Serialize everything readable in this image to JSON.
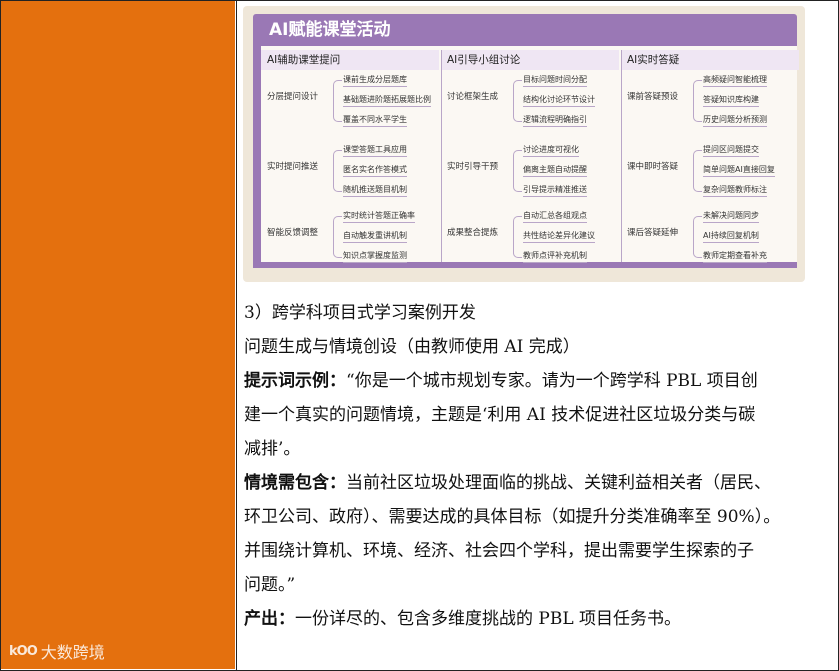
{
  "watermark": {
    "logo": "kOO",
    "text": "大数跨境"
  },
  "figure": {
    "title": "AI赋能课堂活动",
    "columns": [
      {
        "heading": "AI辅助课堂提问",
        "groups": [
          {
            "label": "分层提问设计",
            "leaves": [
              "课前生成分层题库",
              "基础题进阶题拓展题比例",
              "覆盖不同水平学生"
            ]
          },
          {
            "label": "实时提问推送",
            "leaves": [
              "课堂答题工具应用",
              "匿名实名作答模式",
              "随机推送题目机制"
            ]
          },
          {
            "label": "智能反馈调整",
            "leaves": [
              "实时统计答题正确率",
              "自动触发重讲机制",
              "知识点掌握度监测"
            ]
          }
        ]
      },
      {
        "heading": "AI引导小组讨论",
        "groups": [
          {
            "label": "讨论框架生成",
            "leaves": [
              "目标问题时间分配",
              "结构化讨论环节设计",
              "逻辑流程明确指引"
            ]
          },
          {
            "label": "实时引导干预",
            "leaves": [
              "讨论进度可视化",
              "偏离主题自动提醒",
              "引导提示精准推送"
            ]
          },
          {
            "label": "成果整合提炼",
            "leaves": [
              "自动汇总各组观点",
              "共性结论差异化建议",
              "教师点评补充机制"
            ]
          }
        ]
      },
      {
        "heading": "AI实时答疑",
        "groups": [
          {
            "label": "课前答疑预设",
            "leaves": [
              "高频疑问智能梳理",
              "答疑知识库构建",
              "历史问题分析预测"
            ]
          },
          {
            "label": "课中即时答疑",
            "leaves": [
              "提问区问题提交",
              "简单问题AI直接回复",
              "复杂问题教师标注"
            ]
          },
          {
            "label": "课后答疑延伸",
            "leaves": [
              "未解决问题同步",
              "AI持续回复机制",
              "教师定期查看补充"
            ]
          }
        ]
      }
    ]
  },
  "text": {
    "line1": "3）跨学科项目式学习案例开发",
    "line2": "问题生成与情境创设（由教师使用 AI 完成）",
    "prompt_label": "提示词示例：",
    "prompt_l1": "“你是一个城市规划专家。请为一个跨学科 PBL 项目创",
    "prompt_l2": "建一个真实的问题情境，主题是‘利用 AI 技术促进社区垃圾分类与碳",
    "prompt_l3": "减排’。",
    "context_label": "情境需包含：",
    "context_l1": "当前社区垃圾处理面临的挑战、关键利益相关者（居民、",
    "context_l2": "环卫公司、政府）、需要达成的具体目标（如提升分类准确率至 90%）。",
    "context_l3": "并围绕计算机、环境、经济、社会四个学科，提出需要学生探索的子",
    "context_l4": "问题。”",
    "output_label": "产出：",
    "output_text": "一份详尽的、包含多维度挑战的 PBL 项目任务书。"
  }
}
